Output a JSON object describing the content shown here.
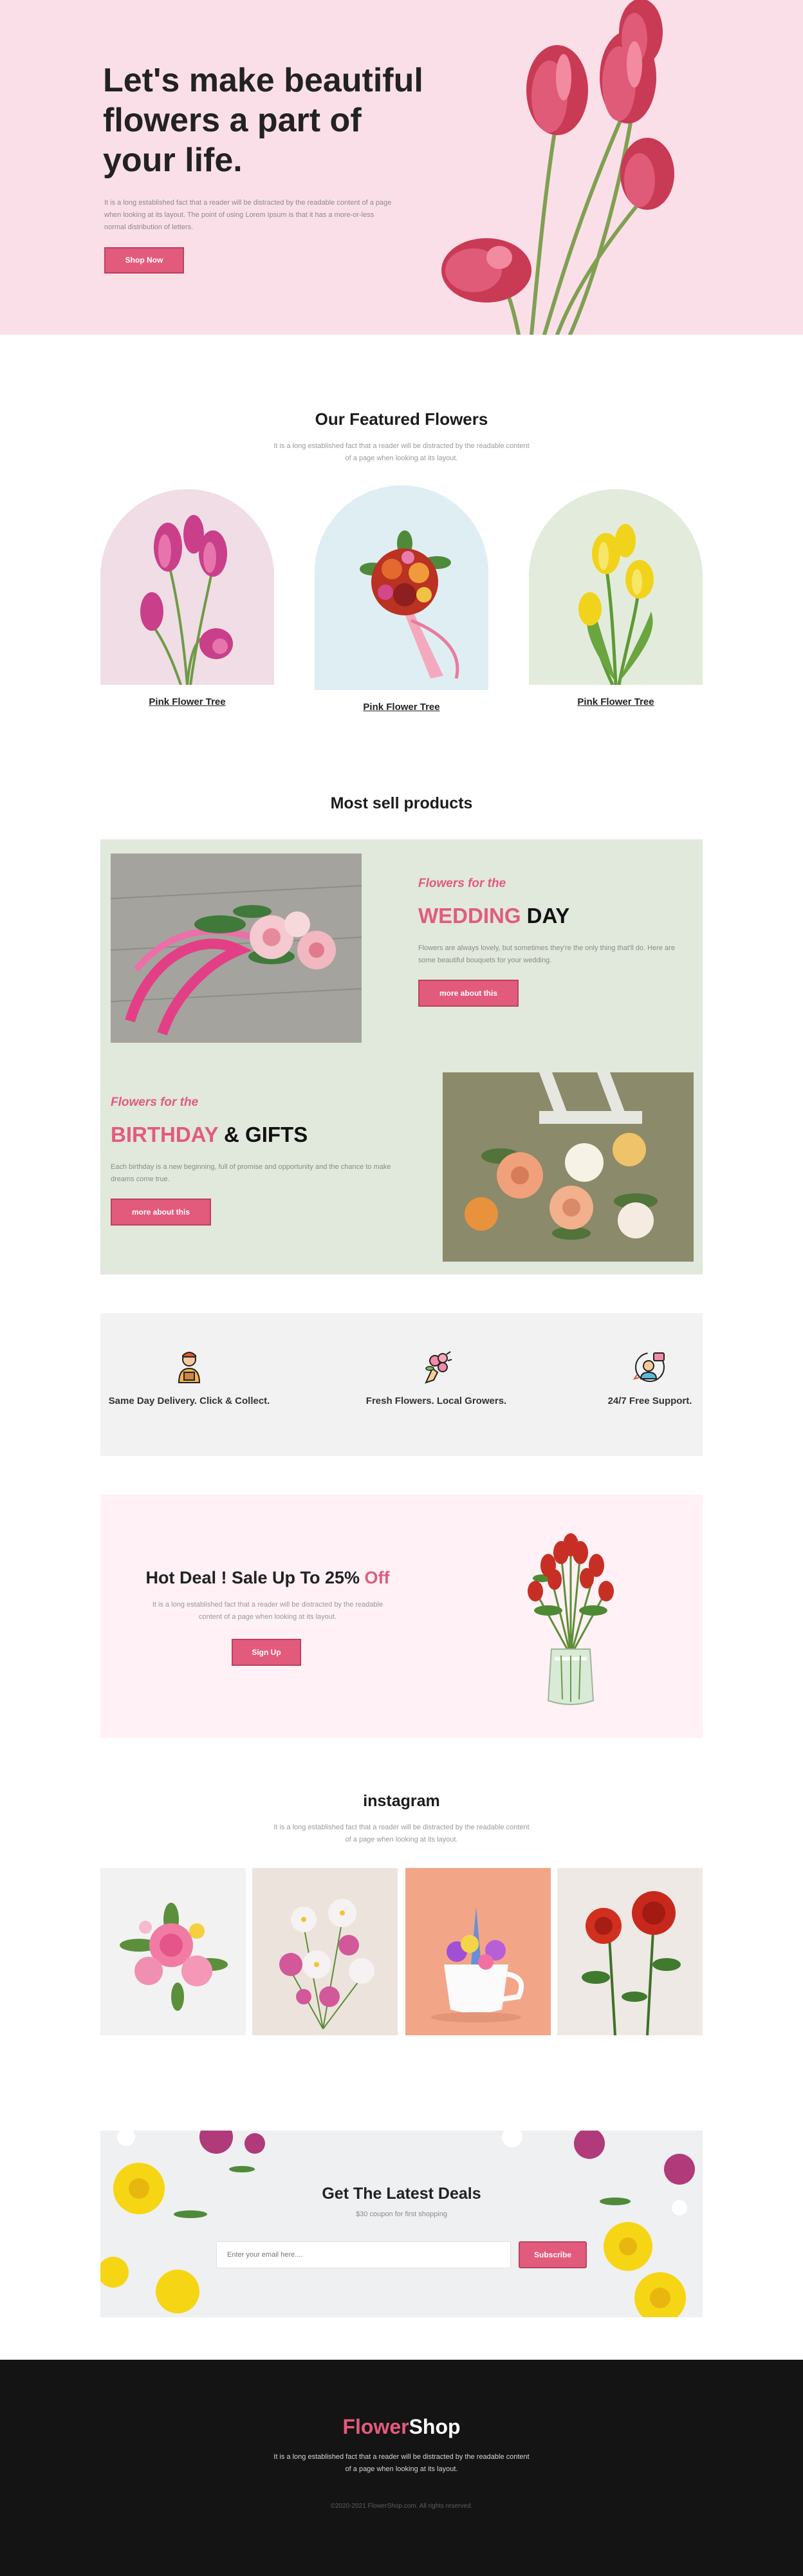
{
  "hero": {
    "title": "Let's make beautiful flowers a part of your life.",
    "text": "It is a long established fact that a reader will be distracted by the readable content of a page when looking at its layout. The point of using Lorem Ipsum is that it has a more-or-less normal distribution of letters.",
    "button": "Shop Now"
  },
  "featured": {
    "title": "Our Featured Flowers",
    "subtitle": "It is a long established fact that a reader will be distracted by the readable content of a page when looking at its layout.",
    "items": [
      {
        "label": "Pink Flower Tree"
      },
      {
        "label": "Pink Flower Tree"
      },
      {
        "label": "Pink Flower Tree"
      }
    ]
  },
  "most_sell": {
    "title": "Most sell products",
    "wedding": {
      "kicker": "Flowers for the",
      "head_accent": "WEDDING",
      "head_rest": " DAY",
      "text": "Flowers are always lovely, but sometimes they're the only thing that'll do. Here are some beautiful bouquets for your wedding.",
      "button": "more about this"
    },
    "birthday": {
      "kicker": "Flowers for the",
      "head_accent": "BIRTHDAY",
      "head_rest": " & GIFTS",
      "text": "Each birthday is a new beginning, full of promise and opportunity and the chance to make dreams come true.",
      "button": "more about this"
    }
  },
  "features": [
    {
      "label": "Same Day Delivery. Click & Collect.",
      "icon": "delivery-person-icon"
    },
    {
      "label": "Fresh Flowers. Local Growers.",
      "icon": "bouquet-icon"
    },
    {
      "label": "24/7 Free Support.",
      "icon": "support-agent-icon"
    }
  ],
  "deal": {
    "title_main": "Hot Deal ! Sale Up To 25% ",
    "title_accent": "Off",
    "text": "It is a long established fact that a reader will be distracted by the readable content of a page when looking at its layout.",
    "button": "Sign Up"
  },
  "instagram": {
    "title": "instagram",
    "subtitle": "It is a long established fact that a reader will be distracted by the readable content of a page when looking at its layout."
  },
  "newsletter": {
    "title": "Get The Latest Deals",
    "subtitle": "$30 coupon for first shopping",
    "placeholder": "Enter your email here....",
    "button": "Subscribe"
  },
  "footer": {
    "logo_accent": "Flower",
    "logo_rest": "Shop",
    "text": "It is a long established fact that a reader will be distracted by the readable content of a page when looking at its layout.",
    "copyright": "©2020-2021 FlowerShop.com. All rights reserved."
  },
  "colors": {
    "accent": "#e35b7c",
    "hero_bg": "#fbdfe8",
    "sell_bg": "#e1e8dc",
    "deal_bg": "#fff1f5",
    "footer_bg": "#141414"
  }
}
